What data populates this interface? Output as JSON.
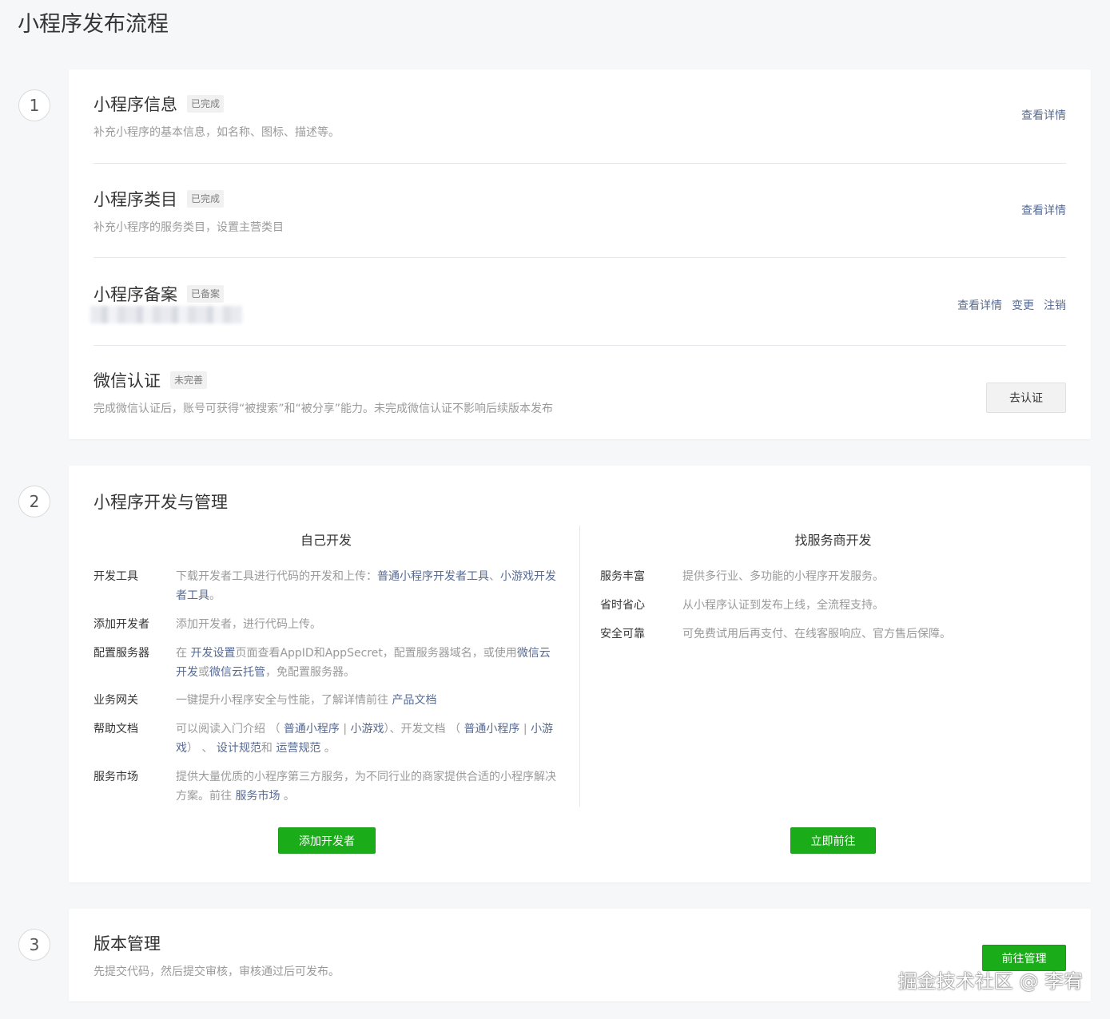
{
  "page": {
    "title": "小程序发布流程"
  },
  "steps": [
    {
      "number": "1"
    },
    {
      "number": "2"
    },
    {
      "number": "3"
    }
  ],
  "step1": {
    "info": {
      "title": "小程序信息",
      "tag": "已完成",
      "desc": "补充小程序的基本信息，如名称、图标、描述等。",
      "link": "查看详情"
    },
    "category": {
      "title": "小程序类目",
      "tag": "已完成",
      "desc": "补充小程序的服务类目，设置主营类目",
      "link": "查看详情"
    },
    "record": {
      "title": "小程序备案",
      "tag": "已备案",
      "links": [
        "查看详情",
        "变更",
        "注销"
      ]
    },
    "wechat_auth": {
      "title": "微信认证",
      "tag": "未完善",
      "desc": "完成微信认证后，账号可获得“被搜索”和“被分享”能力。未完成微信认证不影响后续版本发布",
      "button": "去认证"
    }
  },
  "step2": {
    "title": "小程序开发与管理",
    "self_dev": {
      "title": "自己开发",
      "items": [
        {
          "key": "开发工具",
          "parts": [
            "下载开发者工具进行代码的开发和上传：",
            "普通小程序开发者工具",
            "、",
            "小游戏开发者工具",
            "。"
          ]
        },
        {
          "key": "添加开发者",
          "parts": [
            "添加开发者，进行代码上传。"
          ]
        },
        {
          "key": "配置服务器",
          "parts": [
            "在 ",
            "开发设置",
            "页面查看AppID和AppSecret，配置服务器域名，或使用",
            "微信云开发",
            "或",
            "微信云托管",
            "，免配置服务器。"
          ]
        },
        {
          "key": "业务网关",
          "parts": [
            "一键提升小程序安全与性能，了解详情前往 ",
            "产品文档"
          ]
        },
        {
          "key": "帮助文档",
          "parts": [
            "可以阅读入门介绍 （ ",
            "普通小程序",
            " | ",
            "小游戏",
            "）、开发文档 （ ",
            "普通小程序",
            " | ",
            "小游戏",
            "） 、 ",
            "设计规范",
            "和 ",
            "运营规范",
            " 。"
          ]
        },
        {
          "key": "服务市场",
          "parts": [
            "提供大量优质的小程序第三方服务，为不同行业的商家提供合适的小程序解决方案。前往 ",
            "服务市场",
            " 。"
          ]
        }
      ],
      "button": "添加开发者"
    },
    "provider_dev": {
      "title": "找服务商开发",
      "items": [
        {
          "key": "服务丰富",
          "value": "提供多行业、多功能的小程序开发服务。"
        },
        {
          "key": "省时省心",
          "value": "从小程序认证到发布上线，全流程支持。"
        },
        {
          "key": "安全可靠",
          "value": "可免费试用后再支付、在线客服响应、官方售后保障。"
        }
      ],
      "button": "立即前往"
    }
  },
  "step3": {
    "title": "版本管理",
    "desc": "先提交代码，然后提交审核，审核通过后可发布。",
    "button": "前往管理"
  },
  "watermark": "掘金技术社区 @ 李宥",
  "colors": {
    "primary_green": "#1aad19",
    "link_blue": "#576b95",
    "muted_text": "#9a9a9a"
  }
}
